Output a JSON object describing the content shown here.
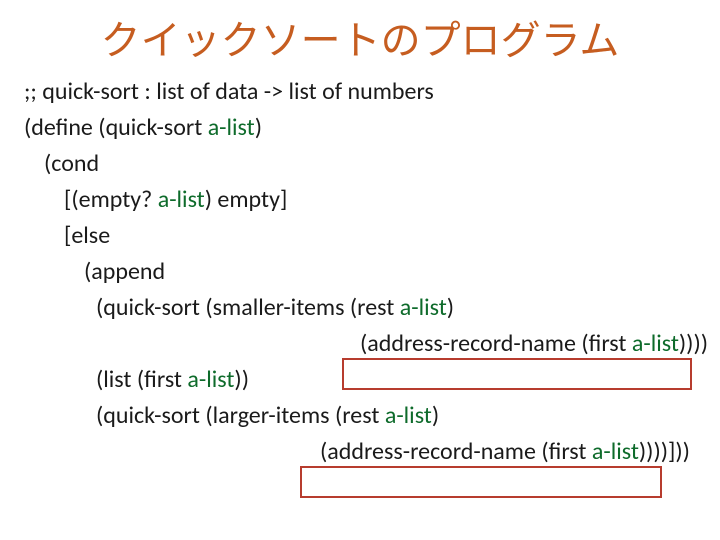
{
  "title": "クイックソートのプログラム",
  "code": {
    "comment": ";; quick-sort : list of data -> list of numbers",
    "define_open": "(define (quick-sort ",
    "alist": "a-list",
    "define_close": ")",
    "cond": "(cond",
    "empty_open": "[(empty? ",
    "empty_close": ") empty]",
    "else": "[else",
    "append": "(append",
    "qs_small_open": "(quick-sort (smaller-items (rest ",
    "qs_small_close": ")",
    "addr1_open": "(address-record-name (first ",
    "addr1_close": "))))",
    "list_open": "(list (first ",
    "list_close": "))",
    "qs_large_open": "(quick-sort (larger-items (rest ",
    "qs_large_close": ")",
    "addr2_open": "(address-record-name (first ",
    "addr2_close": "))))",
    "tail": "]))"
  }
}
